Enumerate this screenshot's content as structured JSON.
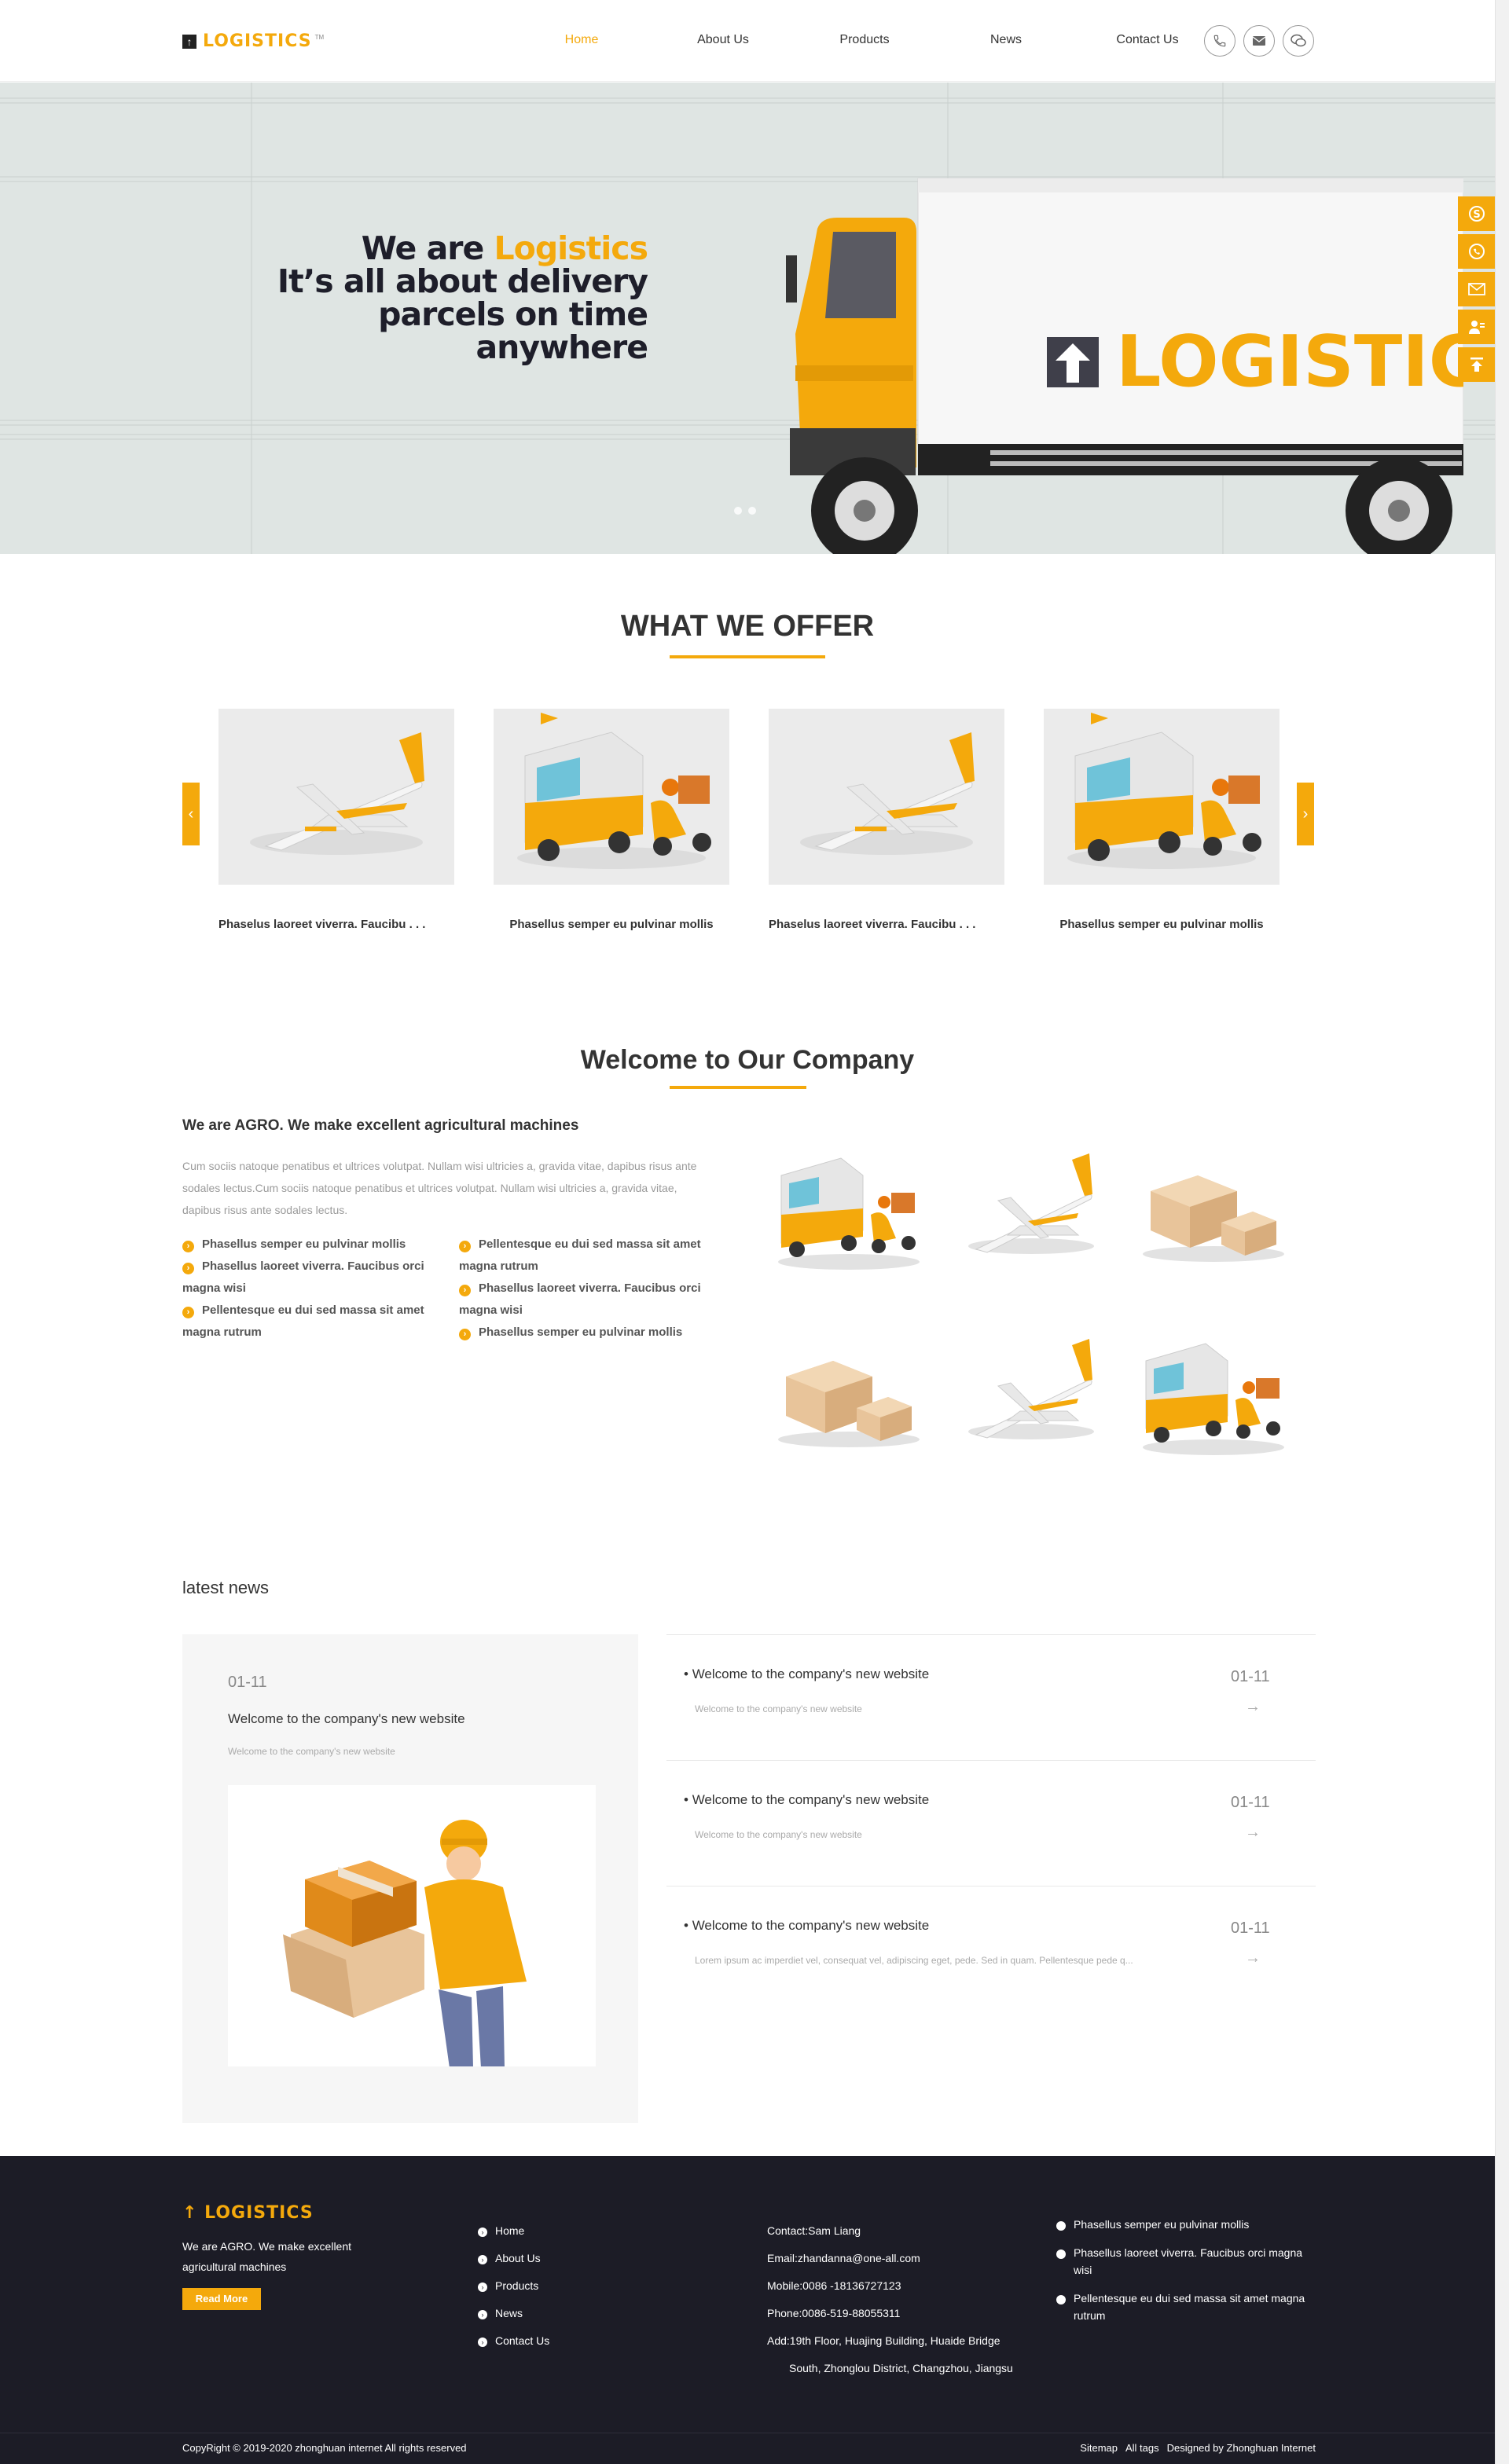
{
  "header": {
    "logo_text": "LOGISTICS",
    "logo_tm": "TM",
    "nav": [
      "Home",
      "About Us",
      "Products",
      "News",
      "Contact Us"
    ],
    "active_nav": "Home",
    "icons": [
      "phone-icon",
      "mail-icon",
      "wechat-icon"
    ]
  },
  "hero": {
    "line1_prefix": "We are ",
    "line1_highlight": "Logistics",
    "line2": "It’s all about delivery",
    "line3": "parcels on time",
    "line4": "anywhere",
    "truck_text": "LOGISTIC",
    "slides": 2
  },
  "sidebar": {
    "icons": [
      "skype-icon",
      "whatsapp-icon",
      "email-icon",
      "contact-icon",
      "back-to-top-icon"
    ]
  },
  "offer": {
    "title": "WHAT WE OFFER",
    "items": [
      {
        "caption": "Phaselus laoreet viverra. Faucibu . . .",
        "image": "airplane"
      },
      {
        "caption": "Phasellus semper eu pulvinar mollis",
        "image": "delivery-truck"
      },
      {
        "caption": "Phaselus laoreet viverra. Faucibu . . .",
        "image": "airplane"
      },
      {
        "caption": "Phasellus semper eu pulvinar mollis",
        "image": "delivery-truck"
      }
    ],
    "prev": "‹",
    "next": "›"
  },
  "welcome": {
    "title": "Welcome to Our Company",
    "heading": "We are AGRO. We make excellent agricultural machines",
    "paragraph": "Cum sociis natoque penatibus et ultrices volutpat. Nullam wisi ultricies a, gravida vitae, dapibus risus ante sodales lectus.Cum sociis natoque penatibus et ultrices volutpat. Nullam wisi ultricies a, gravida vitae, dapibus risus ante sodales lectus.",
    "features_left": [
      "Phasellus semper eu pulvinar mollis",
      "Phasellus laoreet viverra. Faucibus orci magna wisi",
      "Pellentesque eu dui sed massa sit amet magna rutrum"
    ],
    "features_right": [
      "Pellentesque eu dui sed massa sit amet magna rutrum",
      "Phasellus laoreet viverra. Faucibus orci magna wisi",
      "Phasellus semper eu pulvinar mollis"
    ],
    "images": [
      "delivery-truck",
      "airplane",
      "boxes",
      "boxes",
      "airplane",
      "delivery-truck"
    ]
  },
  "news": {
    "title": "latest news",
    "main": {
      "date": "01-11",
      "title": "Welcome to the company's new website",
      "summary": "Welcome to the company's new website"
    },
    "items": [
      {
        "title": "Welcome to the company's new website",
        "summary": "Welcome to the company's new website",
        "date": "01-11",
        "arrow": "→"
      },
      {
        "title": "Welcome to the company's new website",
        "summary": "Welcome to the company's new website",
        "date": "01-11",
        "arrow": "→"
      },
      {
        "title": "Welcome to the company's new website",
        "summary": "Lorem ipsum ac imperdiet vel, consequat vel, adipiscing eget, pede. Sed in quam. Pellentesque pede q...",
        "date": "01-11",
        "arrow": "→"
      }
    ]
  },
  "footer": {
    "logo_text": "LOGISTICS",
    "description": "We are AGRO. We make excellent agricultural machines",
    "read_more": "Read More",
    "links": [
      "Home",
      "About Us",
      "Products",
      "News",
      "Contact Us"
    ],
    "contact": {
      "contact": "Contact:Sam Liang",
      "email": "Email:zhandanna@one-all.com",
      "mobile": "Mobile:0086 -18136727123",
      "phone": "Phone:0086-519-88055311",
      "address1": "Add:19th Floor, Huajing Building, Huaide Bridge",
      "address2": "South, Zhonglou District, Changzhou, Jiangsu"
    },
    "news": [
      "Phasellus semper eu pulvinar mollis",
      "Phasellus laoreet viverra. Faucibus orci magna wisi",
      "Pellentesque eu dui sed massa sit amet magna rutrum"
    ],
    "copyright": "CopyRight © 2019-2020   zhonghuan internet  All rights reserved",
    "bottom_links": [
      "Sitemap",
      "All tags",
      "Designed by Zhonghuan Internet"
    ]
  },
  "colors": {
    "accent": "#f4a90c",
    "dark": "#1c1c26",
    "hero_bg": "#dfe5e3"
  }
}
